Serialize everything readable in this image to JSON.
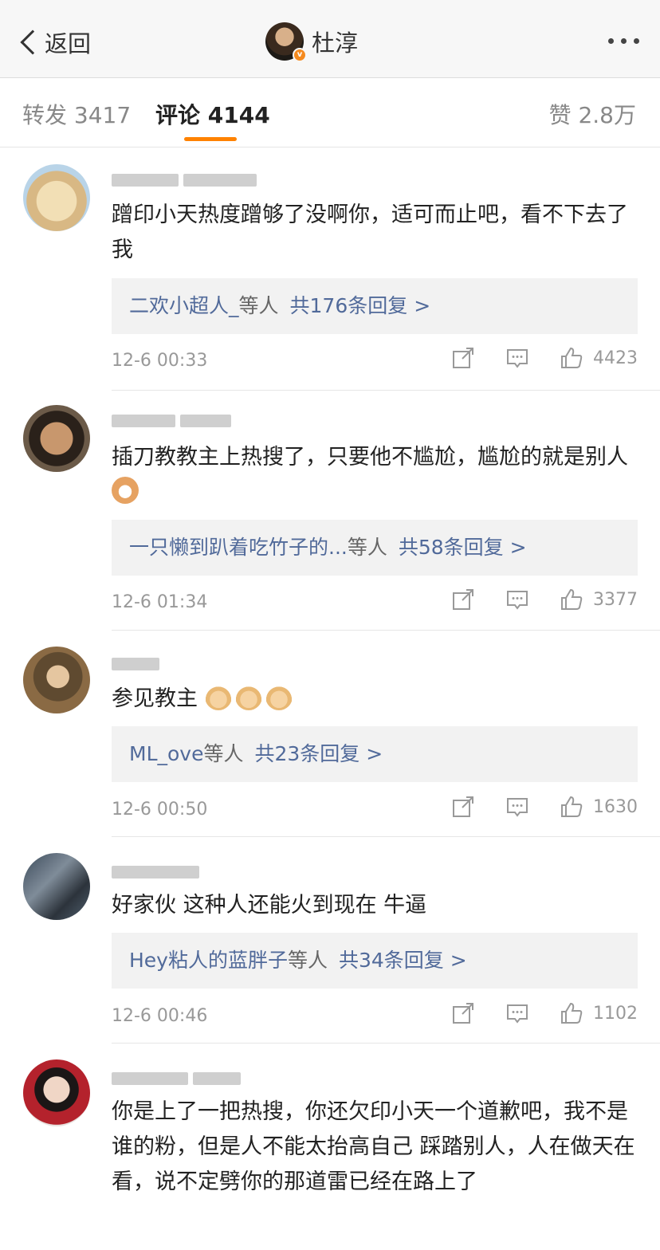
{
  "header": {
    "back_label": "返回",
    "author_name": "杜淳",
    "verified_badge": "v"
  },
  "tabs": {
    "repost": "转发 3417",
    "comment": "评论 4144",
    "like": "赞 2.8万"
  },
  "comments": [
    {
      "text": "蹭印小天热度蹭够了没啊你，适可而止吧，看不下去了我",
      "reply_users": "二欢小超人_",
      "reply_etc": "等人",
      "reply_count": "共176条回复 >",
      "time": "12-6 00:33",
      "likes": "4423"
    },
    {
      "text": "插刀教教主上热搜了，只要他不尴尬，尴尬的就是别人",
      "reply_users": "一只懒到趴着吃竹子的...",
      "reply_etc": "等人",
      "reply_count": "共58条回复 >",
      "time": "12-6 01:34",
      "likes": "3377"
    },
    {
      "text": "参见教主",
      "reply_users": "ML_ove",
      "reply_etc": "等人",
      "reply_count": "共23条回复 >",
      "time": "12-6 00:50",
      "likes": "1630"
    },
    {
      "text": "好家伙 这种人还能火到现在 牛逼",
      "reply_users": "Hey粘人的蓝胖子",
      "reply_etc": "等人",
      "reply_count": "共34条回复 >",
      "time": "12-6 00:46",
      "likes": "1102"
    },
    {
      "text": "你是上了一把热搜，你还欠印小天一个道歉吧，我不是谁的粉，但是人不能太抬高自己 踩踏别人，人在做天在看，说不定劈你的那道雷已经在路上了"
    }
  ],
  "colors": {
    "accent": "#ff8200",
    "link": "#516a9a",
    "verified": "#f58a1f"
  },
  "icons": [
    "back-chevron-icon",
    "more-icon",
    "share-icon",
    "comment-icon",
    "like-icon"
  ]
}
